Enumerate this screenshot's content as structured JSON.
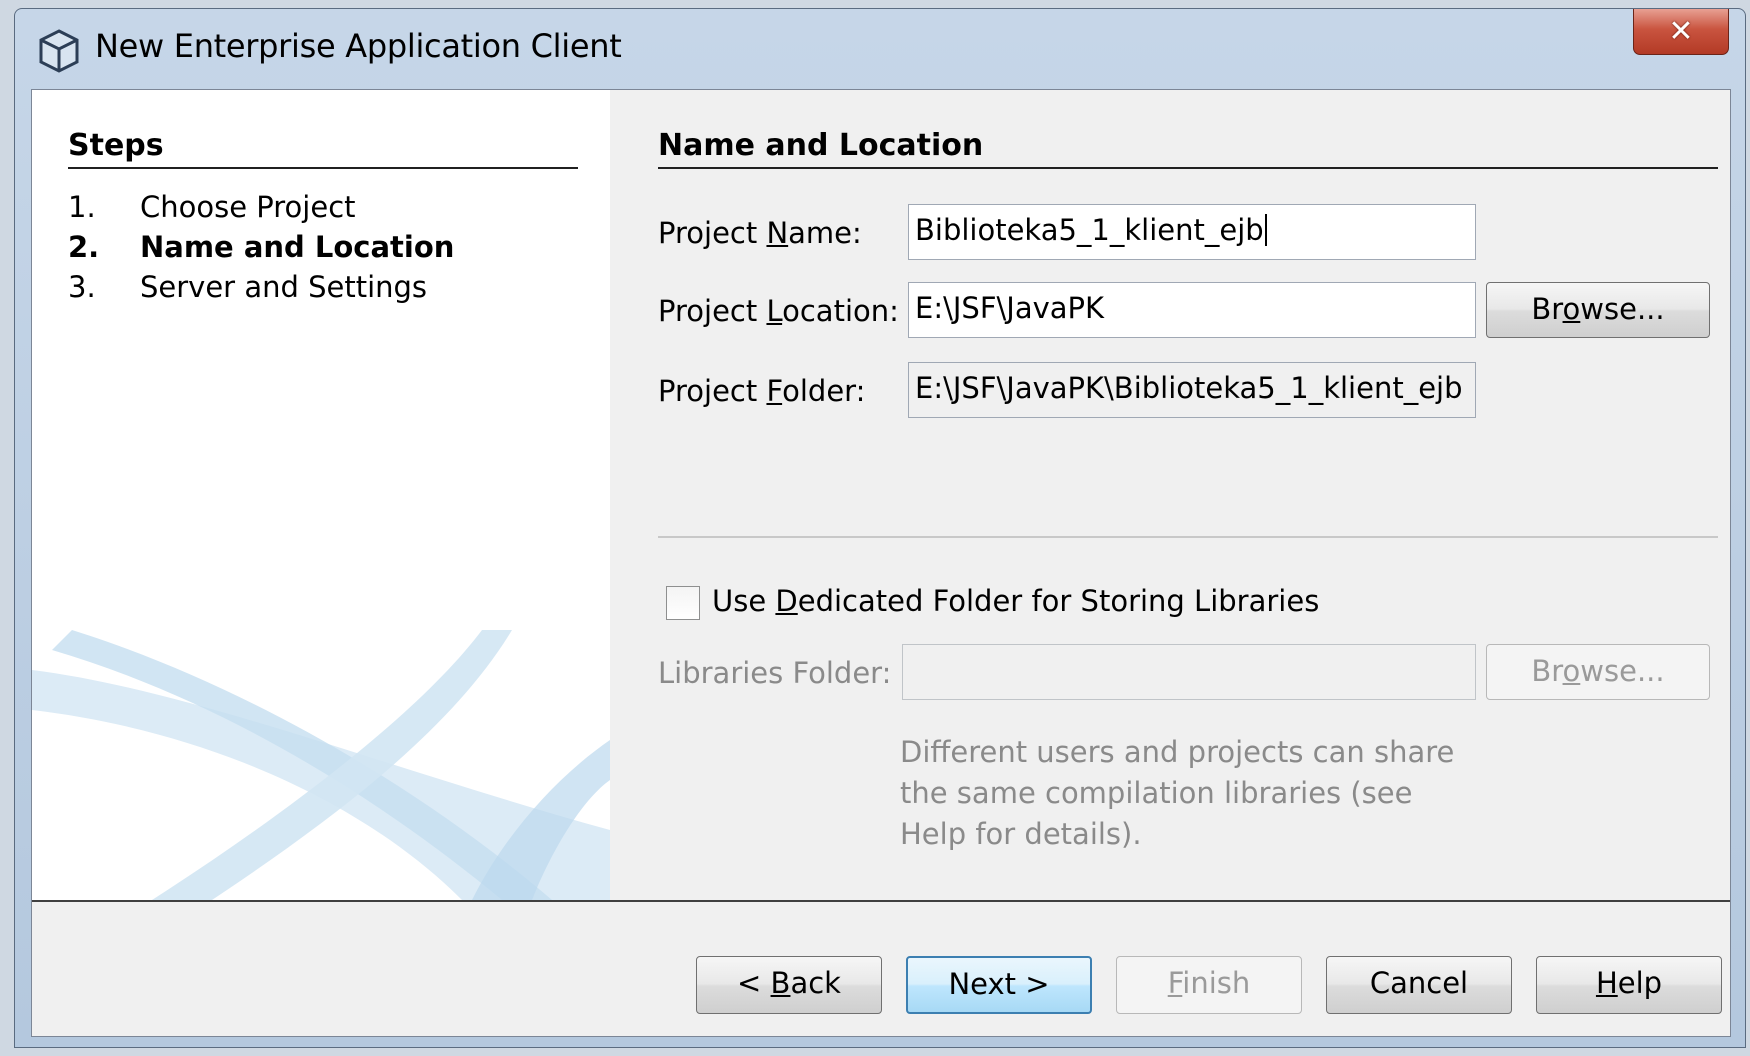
{
  "window": {
    "title": "New Enterprise Application Client",
    "close_glyph": "✕"
  },
  "steps": {
    "heading": "Steps",
    "items": [
      {
        "num": "1.",
        "label": "Choose Project",
        "active": false
      },
      {
        "num": "2.",
        "label": "Name and Location",
        "active": true
      },
      {
        "num": "3.",
        "label": "Server and Settings",
        "active": false
      }
    ]
  },
  "main": {
    "heading": "Name and Location",
    "project_name": {
      "label_pre": "Project ",
      "label_mnemonic": "N",
      "label_post": "ame:",
      "value": "Biblioteka5_1_klient_ejb"
    },
    "project_location": {
      "label_pre": "Project ",
      "label_mnemonic": "L",
      "label_post": "ocation:",
      "value": "E:\\JSF\\JavaPK"
    },
    "project_folder": {
      "label_pre": "Project ",
      "label_mnemonic": "F",
      "label_post": "older:",
      "value": "E:\\JSF\\JavaPK\\Biblioteka5_1_klient_ejb"
    },
    "browse_label_pre": "Br",
    "browse_label_mnemonic": "o",
    "browse_label_post": "wse...",
    "dedicated_folder": {
      "label_pre": "Use ",
      "label_mnemonic": "D",
      "label_post": "edicated Folder for Storing Libraries",
      "checked": false
    },
    "libraries_folder": {
      "label": "Libraries Folder:",
      "value": ""
    },
    "help_text": "Different users and projects can share the same compilation libraries (see Help for details)."
  },
  "footer": {
    "back": {
      "pre": "< ",
      "mnemonic": "B",
      "post": "ack"
    },
    "next": {
      "label": "Next >"
    },
    "finish": {
      "pre": "",
      "mnemonic": "F",
      "post": "inish"
    },
    "cancel": {
      "label": "Cancel"
    },
    "help": {
      "pre": "",
      "mnemonic": "H",
      "post": "elp"
    }
  },
  "colors": {
    "primary_button_border": "#3c7fb1",
    "close_button": "#c9543f",
    "disabled_text": "#8a8a8a"
  }
}
